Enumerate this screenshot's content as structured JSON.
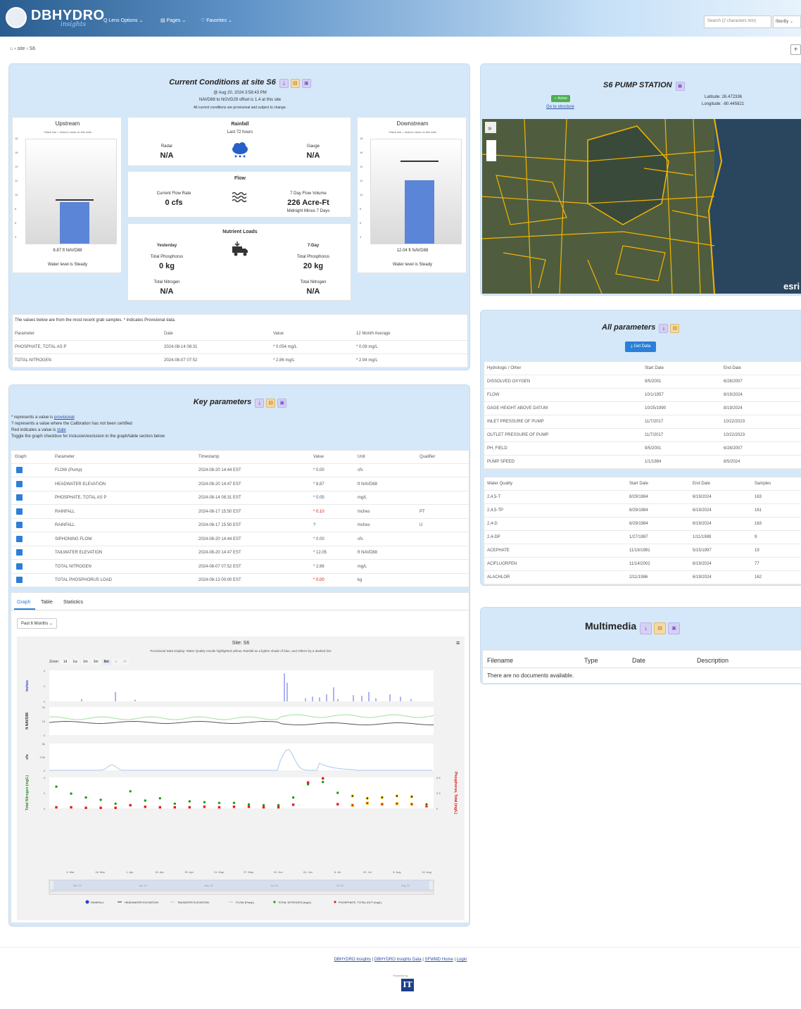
{
  "app": {
    "title": "DBHYDRO",
    "subtitle": "insights",
    "nav": [
      "Q Lens Options ⌄",
      "▤ Pages ⌄",
      "♡ Favorites ⌄"
    ],
    "search_placeholder": "Search (2 characters min)",
    "filter": "filterBy ⌄"
  },
  "breadcrumb": {
    "home": "⌂",
    "sep": "›",
    "site": "site",
    "current": "S6"
  },
  "conditions": {
    "title": "Current Conditions at site S6",
    "datetime": "@ Aug 20, 2024 3:58:43 PM",
    "offset": "NAVD88 to NGVD29 offset is 1.4 at this site",
    "note": "All current conditions are provisional and subject to change.",
    "upstream": {
      "title": "Upstream",
      "note": "*black line = historic value on this date",
      "value": "8.87 ft NAVD88",
      "status": "Water level is Steady",
      "level": 8.87,
      "historic": 9.1
    },
    "downstream": {
      "title": "Downstream",
      "note": "*black line = historic value on this date",
      "value": "12.04 ft NAVD88",
      "status": "Water level is Steady",
      "level": 12.04,
      "historic": 14.6
    },
    "yticks": [
      "18",
      "16",
      "14",
      "12",
      "10",
      "8",
      "6",
      "4"
    ],
    "rainfall": {
      "title": "Rainfall",
      "sub": "Last 72 hours",
      "radar_label": "Radar",
      "radar": "N/A",
      "gauge_label": "Gauge",
      "gauge": "N/A"
    },
    "flow": {
      "title": "Flow",
      "rate_label": "Current Flow Rate",
      "rate": "0 cfs",
      "vol_label": "7 Day Flow Volume",
      "vol": "226 Acre-Ft",
      "vol_sub": "Midnight Minus 7 Days"
    },
    "nutrient": {
      "title": "Nutrient Loads",
      "yesterday": "Yesterday",
      "seven": "7-Day",
      "tp_label": "Total Phosphorus",
      "tp_y": "0 kg",
      "tp_7": "20 kg",
      "tn_label": "Total Nitrogen",
      "tn_y": "N/A",
      "tn_7": "N/A"
    },
    "grab_note": "The values below are from the most recent grab samples. * indicates Provisional data.",
    "grab_headers": [
      "Parameter",
      "Date",
      "Value",
      "12 Month Average"
    ],
    "grab_rows": [
      [
        "PHOSPHATE, TOTAL AS P",
        "2024-08-14 08:31",
        "* 0.054 mg/L",
        "* 0.08 mg/L"
      ],
      [
        "TOTAL NITROGEN",
        "2024-08-07 07:52",
        "* 2.86 mg/L",
        "* 2.94 mg/L"
      ]
    ]
  },
  "pump": {
    "title": "S6 PUMP STATION",
    "status": "✓ Active",
    "goto": "Go to structure",
    "lat": "Latitude: 26.472336",
    "lon": "Longitude: -80.445821",
    "esri": "esri"
  },
  "allparams": {
    "title": "All parameters",
    "get": "⤓ Get Data",
    "hydro_headers": [
      "Hydrologic / Other",
      "Start Date",
      "End Date"
    ],
    "hydro_rows": [
      [
        "DISSOLVED OXYGEN",
        "9/5/2001",
        "6/28/2007"
      ],
      [
        "FLOW",
        "10/1/1957",
        "8/19/2024"
      ],
      [
        "GAGE HEIGHT ABOVE DATUM",
        "10/25/1990",
        "8/19/2024"
      ],
      [
        "INLET PRESSURE OF PUMP",
        "11/7/2017",
        "10/22/2023"
      ],
      [
        "OUTLET PRESSURE OF PUMP",
        "11/7/2017",
        "10/22/2023"
      ],
      [
        "PH, FIELD",
        "9/5/2001",
        "6/28/2007"
      ],
      [
        "PUMP SPEED",
        "1/1/1984",
        "8/5/2024"
      ]
    ],
    "wq_headers": [
      "Water Quality",
      "Start Date",
      "End Date",
      "Samples"
    ],
    "wq_rows": [
      [
        "2,4,5-T",
        "8/29/1984",
        "6/19/2024",
        "163"
      ],
      [
        "2,4,5-TP",
        "8/29/1984",
        "6/19/2024",
        "161"
      ],
      [
        "2,4-D",
        "8/29/1984",
        "6/19/2024",
        "163"
      ],
      [
        "2,4-DP",
        "1/27/1987",
        "1/11/1989",
        "9"
      ],
      [
        "ACEPHATE",
        "11/19/1991",
        "5/15/1997",
        "19"
      ],
      [
        "ACIFLUORFEN",
        "11/14/2002",
        "6/19/2024",
        "77"
      ],
      [
        "ALACHLOR",
        "2/11/1986",
        "6/19/2024",
        "162"
      ]
    ]
  },
  "multimedia": {
    "title": "Multimedia",
    "headers": [
      "Filename",
      "Type",
      "Date",
      "Description"
    ],
    "empty": "There are no documents available."
  },
  "keyparams": {
    "title": "Key parameters",
    "notes": [
      {
        "pre": "* represents a value is ",
        "link": "provisional"
      },
      {
        "pre": "? represents a value where the Calibration has not been certified",
        "link": ""
      },
      {
        "pre": "Red indicates a value is ",
        "link": "stale"
      },
      {
        "pre": "Toggle the graph checkbox for inclusion/exclusion in the graph/table section below",
        "link": ""
      }
    ],
    "headers": [
      "Graph",
      "Parameter",
      "Timestamp",
      "Value",
      "Unit",
      "Qualifier"
    ],
    "rows": [
      [
        "FLOW (Pump)",
        "2024-08-20 14:44 EST",
        "* 0.00",
        "cfs",
        "",
        false
      ],
      [
        "HEADWATER ELEVATION",
        "2024-08-20 14:47 EST",
        "* 8.87",
        "ft NAVD88",
        "",
        false
      ],
      [
        "PHOSPHATE, TOTAL AS P",
        "2024-08-14 08:31 EST",
        "* 0.05",
        "mg/L",
        "",
        false
      ],
      [
        "RAINFALL",
        "2024-08-17 15:50 EST",
        "* 0.10",
        "Inches",
        "PT",
        true
      ],
      [
        "RAINFALL",
        "2024-08-17 15:50 EST",
        "?",
        "Inches",
        "U",
        false
      ],
      [
        "SIPHONING FLOW",
        "2024-08-20 14:44 EST",
        "* 0.00",
        "cfs",
        "",
        false
      ],
      [
        "TAILWATER ELEVATION",
        "2024-08-20 14:47 EST",
        "* 12.05",
        "ft NAVD88",
        "",
        false
      ],
      [
        "TOTAL NITROGEN",
        "2024-08-07 07:52 EST",
        "* 2.86",
        "mg/L",
        "",
        false
      ],
      [
        "TOTAL PHOSPHORUS LOAD",
        "2024-08-13 00:00 EST",
        "* 0.00",
        "kg",
        "",
        true
      ]
    ],
    "tabs": [
      "Graph",
      "Table",
      "Statistics"
    ],
    "range": "Past 6 Months ⌄"
  },
  "chart_data": {
    "type": "line",
    "title": "Site: S6",
    "subtitle": "Provisional Data Display: Water Quality results highlighted yellow, Rainfall as a lighter shade of blue, and Others by a dashed line",
    "zoom_label": "Zoom",
    "zoom": [
      "1d",
      "1w",
      "1m",
      "3m",
      "6m",
      "ty",
      "All"
    ],
    "x_ticks": [
      "4. Mar",
      "18. Mar",
      "1. Apr",
      "15. Apr",
      "29. Apr",
      "13. May",
      "27. May",
      "10. Jun",
      "24. Jun",
      "8. Jul",
      "22. Jul",
      "5. Aug",
      "19. Aug"
    ],
    "nav_ticks": [
      "Mar '24",
      "Apr '24",
      "May '24",
      "Jun '24",
      "Jul '24",
      "Aug '24"
    ],
    "panes": [
      {
        "ylabel": "Inches",
        "yticks": [
          "4",
          "2",
          "0"
        ]
      },
      {
        "ylabel": "ft NAVD88",
        "yticks": [
          "20",
          "10",
          "0"
        ]
      },
      {
        "ylabel": "cfs",
        "yticks": [
          "5k",
          "2.5k",
          "0"
        ]
      },
      {
        "ylabel": "Total Nitrogen (mg/L)",
        "yticks": [
          "4",
          "2",
          "0"
        ],
        "ylabel2": "Phosphorus, Total (mg/L)",
        "yticks2": [
          "0.6",
          "0.3",
          "0"
        ]
      }
    ],
    "legend": [
      "RAINFALL",
      "HEADWATER ELEVATION",
      "TAILWATER ELEVATION",
      "FLOW (Pump)",
      "TOTAL NITROGEN (mg/L)",
      "PHOSPHATE, TOTAL AS P (mg/L)"
    ],
    "series": [
      {
        "name": "TOTAL NITROGEN (mg/L)",
        "values": [
          2.8,
          1.9,
          1.4,
          1.1,
          0.6,
          2.2,
          1.0,
          1.3,
          0.6,
          0.9,
          0.8,
          0.7,
          0.7,
          0.5,
          0.4,
          0.4,
          1.4,
          3.1,
          3.4,
          2.0,
          1.6,
          1.3,
          1.4,
          1.6,
          1.5,
          0.5
        ]
      },
      {
        "name": "PHOSPHATE, TOTAL AS P (mg/L)",
        "values": [
          0.02,
          0.02,
          0.01,
          0.01,
          0.01,
          0.06,
          0.03,
          0.02,
          0.02,
          0.02,
          0.03,
          0.02,
          0.03,
          0.03,
          0.02,
          0.02,
          0.07,
          0.5,
          0.58,
          0.08,
          0.06,
          0.1,
          0.08,
          0.09,
          0.08,
          0.04
        ]
      }
    ]
  },
  "footer": {
    "links": [
      "DBHYDRO Insights",
      "DBHYDRO Insights Data",
      "SFWMD Home",
      "Login"
    ],
    "sep": "|",
    "powered": "Powered by"
  }
}
